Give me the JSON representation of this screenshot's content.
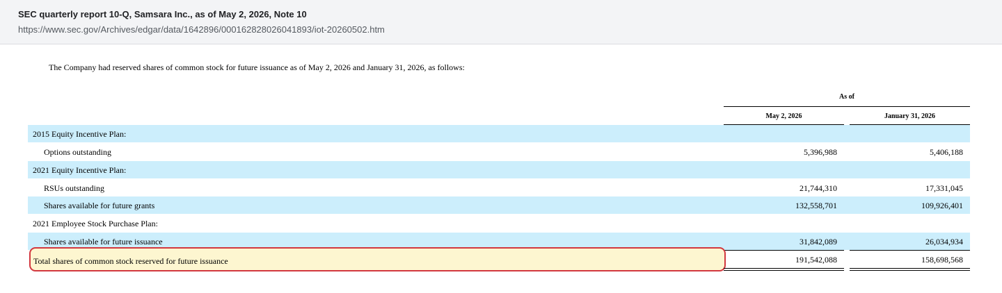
{
  "header": {
    "title": "SEC quarterly report 10-Q, Samsara Inc., as of May 2, 2026, Note 10",
    "url": "https://www.sec.gov/Archives/edgar/data/1642896/000162828026041893/iot-20260502.htm"
  },
  "intro": "The Company had reserved shares of common stock for future issuance as of May 2, 2026 and January 31, 2026, as follows:",
  "table": {
    "as_of": "As of",
    "col1": "May 2, 2026",
    "col2": "January 31, 2026",
    "rows": [
      {
        "label": "2015 Equity Incentive Plan:",
        "v1": "",
        "v2": ""
      },
      {
        "label": "Options outstanding",
        "v1": "5,396,988",
        "v2": "5,406,188"
      },
      {
        "label": "2021 Equity Incentive Plan:",
        "v1": "",
        "v2": ""
      },
      {
        "label": "RSUs outstanding",
        "v1": "21,744,310",
        "v2": "17,331,045"
      },
      {
        "label": "Shares available for future grants",
        "v1": "132,558,701",
        "v2": "109,926,401"
      },
      {
        "label": "2021 Employee Stock Purchase Plan:",
        "v1": "",
        "v2": ""
      },
      {
        "label": "Shares available for future issuance",
        "v1": "31,842,089",
        "v2": "26,034,934"
      }
    ],
    "total": {
      "label": "Total shares of common stock reserved for future issuance",
      "v1": "191,542,088",
      "v2": "158,698,568"
    }
  },
  "colors": {
    "row_highlight": "#cceefc",
    "total_highlight": "#fdf6d0",
    "total_outline": "#d2373e"
  }
}
